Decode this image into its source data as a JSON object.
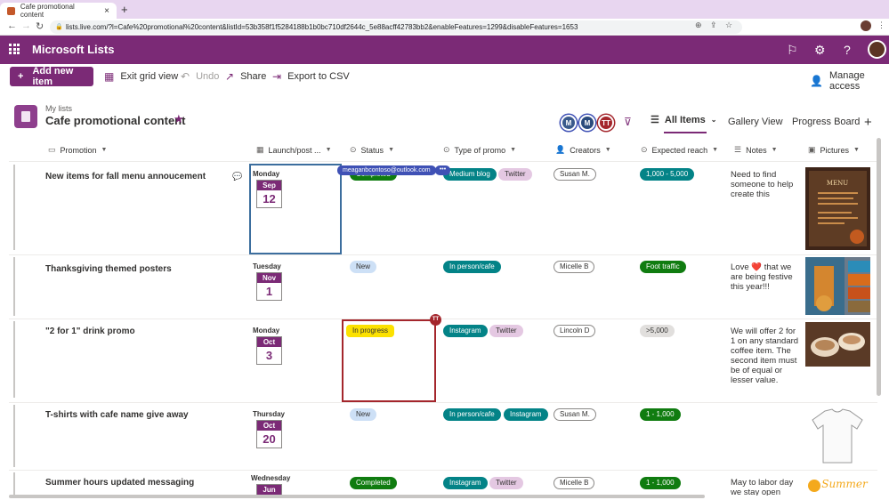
{
  "browser": {
    "tab_title": "Cafe promotional content",
    "new_tab": "+",
    "url": "lists.live.com/?l=Cafe%20promotional%20content&listId=53b358f1f5284188b1b0bc710df2644c_5e88acff42783bb2&enableFeatures=1299&disableFeatures=1653"
  },
  "suite": {
    "app_name": "Microsoft Lists"
  },
  "command_bar": {
    "new_item": "Add new item",
    "exit_grid": "Exit grid view",
    "undo": "Undo",
    "share": "Share",
    "export": "Export to CSV",
    "manage_access": "Manage access"
  },
  "list": {
    "breadcrumb": "My lists",
    "title": "Cafe promotional content",
    "members": [
      {
        "initials": "M",
        "color": "#3a5a8c"
      },
      {
        "initials": "M",
        "color": "#2a4a7c"
      },
      {
        "initials": "TT",
        "color": "#a4262c"
      }
    ]
  },
  "views": {
    "active": "All Items",
    "gallery": "Gallery View",
    "board": "Progress Board"
  },
  "columns": [
    "Promotion",
    "Launch/post ...",
    "Status",
    "Type of promo",
    "Creators",
    "Expected reach",
    "Notes",
    "Pictures"
  ],
  "rows": [
    {
      "promotion": "New items for fall menu annoucement",
      "weekday": "Monday",
      "month": "Sep",
      "day": "12",
      "status": "Completed",
      "types": [
        "Medium blog",
        "Twitter"
      ],
      "creator": "Susan M.",
      "reach": "1,000 - 5,000",
      "notes": "Need to find someone to help create this"
    },
    {
      "promotion": "Thanksgiving themed posters",
      "weekday": "Tuesday",
      "month": "Nov",
      "day": "1",
      "status": "New",
      "types": [
        "In person/cafe"
      ],
      "creator": "Micelle B",
      "reach": "Foot traffic",
      "notes": "Love ❤️ that we are being festive this year!!!"
    },
    {
      "promotion": "\"2 for 1\" drink promo",
      "weekday": "Monday",
      "month": "Oct",
      "day": "3",
      "status": "In progress",
      "types": [
        "Instagram",
        "Twitter"
      ],
      "creator": "Lincoln D",
      "reach": ">5,000",
      "notes": "We will offer 2 for 1 on any standard coffee item. The second item must be of equal or lesser value."
    },
    {
      "promotion": "T-shirts with cafe name give away",
      "weekday": "Thursday",
      "month": "Oct",
      "day": "20",
      "status": "New",
      "types": [
        "In person/cafe",
        "Instagram"
      ],
      "creator": "Susan M.",
      "reach": "1 - 1,000",
      "notes": ""
    },
    {
      "promotion": "Summer hours updated messaging",
      "weekday": "Wednesday",
      "month": "Jun",
      "day": "",
      "status": "Completed",
      "types": [
        "Instagram",
        "Twitter"
      ],
      "creator": "Micelle B",
      "reach": "1 - 1,000",
      "notes": "May to labor day we stay open"
    }
  ],
  "collab": {
    "email": "meaganbcontoso@outlook.com",
    "more": "•••",
    "badge": "TT"
  },
  "picture_text": {
    "menu": "MENU",
    "summer": "Summer"
  }
}
